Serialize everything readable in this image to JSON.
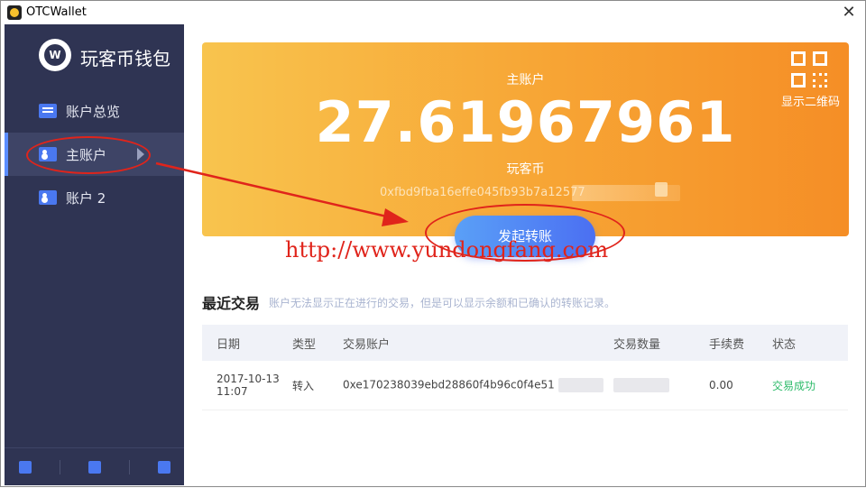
{
  "window": {
    "title": "OTCWallet",
    "close_glyph": "✕"
  },
  "sidebar": {
    "logo_text": "玩客币钱包",
    "items": [
      {
        "label": "账户总览",
        "icon": "list-icon"
      },
      {
        "label": "主账户",
        "icon": "account-icon",
        "active": true
      },
      {
        "label": "账户 2",
        "icon": "account-icon"
      }
    ],
    "footer_buttons": [
      "add-account-icon",
      "import-icon",
      "settings-icon"
    ]
  },
  "account_card": {
    "label": "主账户",
    "balance": "27.61967961",
    "currency": "玩客币",
    "address": "0xfbd9fba16effe045fb93b7a12577",
    "qr_label": "显示二维码"
  },
  "send_button": {
    "label": "发起转账"
  },
  "watermark": "http://www.yundongfang.com",
  "recent": {
    "title": "最近交易",
    "note": "账户无法显示正在进行的交易，但是可以显示余额和已确认的转账记录。",
    "columns": [
      "日期",
      "类型",
      "交易账户",
      "交易数量",
      "手续费",
      "状态"
    ],
    "rows": [
      {
        "date_line1": "2017-10-13",
        "date_line2": "11:07",
        "type": "转入",
        "account": "0xe170238039ebd28860f4b96c0f4e51",
        "amount": "",
        "fee": "0.00",
        "status": "交易成功"
      }
    ]
  },
  "colors": {
    "sidebar_bg": "#2f3453",
    "card_start": "#f8c44e",
    "card_end": "#f58e26",
    "accent": "#4b6ff2",
    "success": "#2dbb6a",
    "annotation": "#e0241b"
  }
}
